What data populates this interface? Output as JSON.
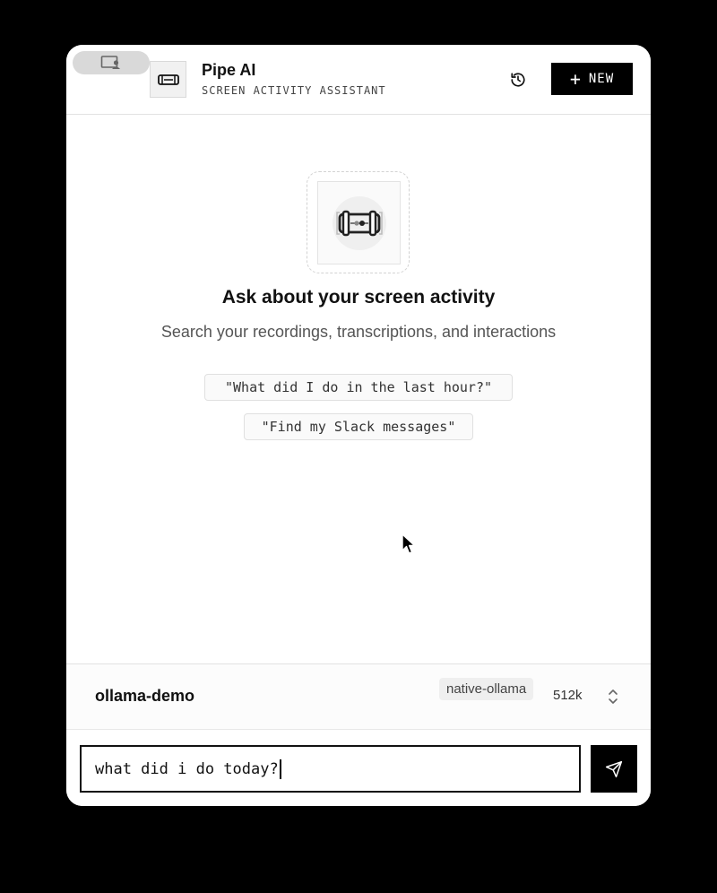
{
  "header": {
    "title": "Pipe AI",
    "subtitle": "SCREEN ACTIVITY ASSISTANT",
    "new_button_label": "NEW",
    "icons": [
      "display-user-icon",
      "pipe-logo-icon",
      "history-icon",
      "plus-icon"
    ]
  },
  "empty_state": {
    "title": "Ask about your screen activity",
    "subtitle": "Search your recordings, transcriptions, and interactions",
    "suggestions": [
      "\"What did I do in the last hour?\"",
      "\"Find my Slack messages\""
    ]
  },
  "model_bar": {
    "preset_name": "ollama-demo",
    "provider": "native-ollama",
    "context_size": "512k"
  },
  "input": {
    "value": "what did i do today?"
  },
  "colors": {
    "accent": "#000000",
    "background": "#ffffff",
    "desktop": "#000000"
  }
}
